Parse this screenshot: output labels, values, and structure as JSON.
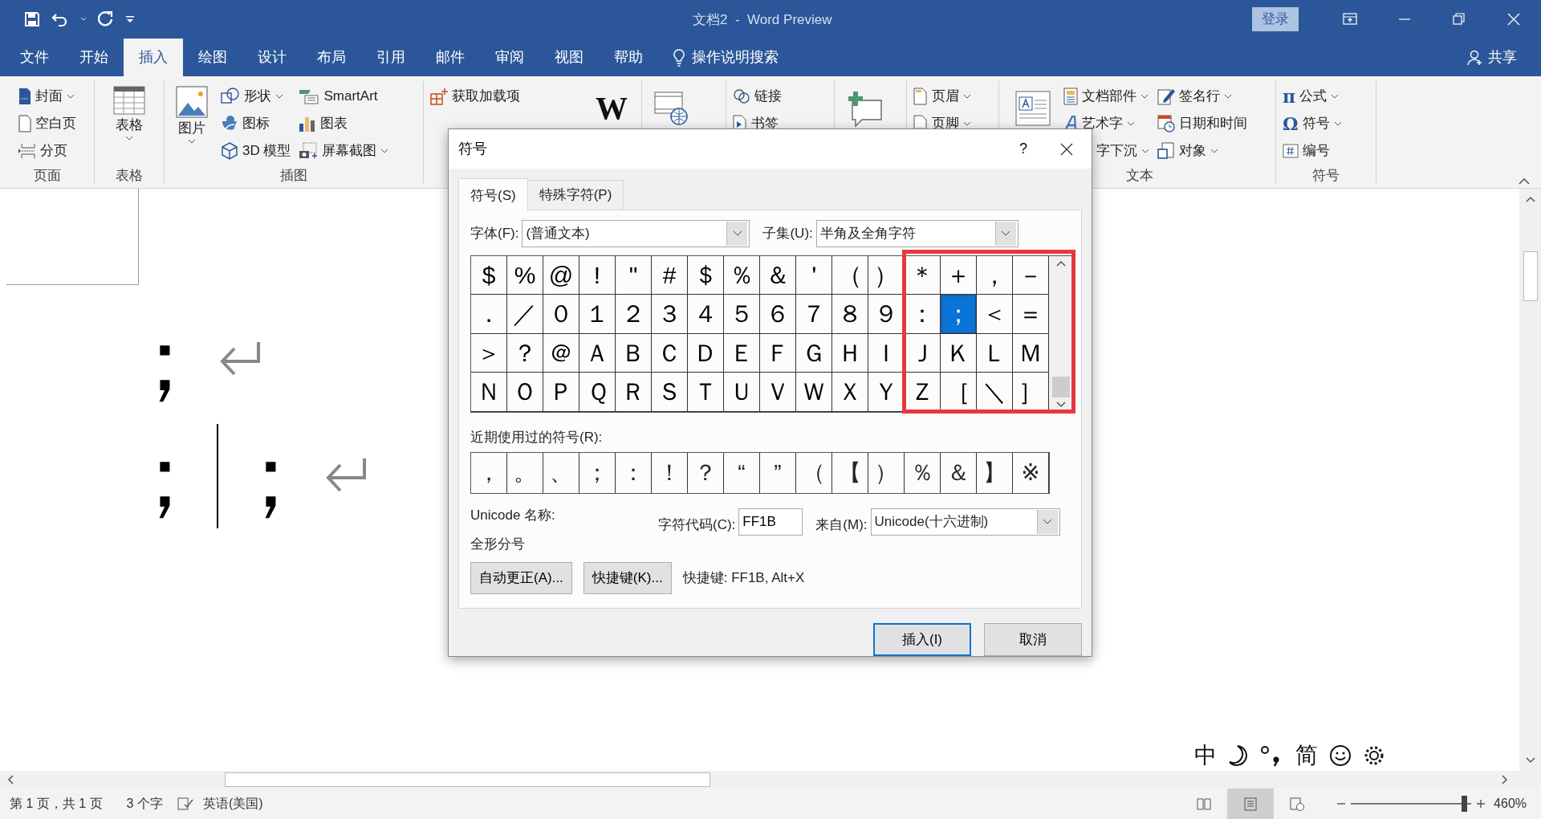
{
  "title_bar": {
    "document_title": "文档2  -  Word Preview",
    "sign_in": "登录"
  },
  "menu_tabs": [
    {
      "label": "文件",
      "selected": false
    },
    {
      "label": "开始",
      "selected": false
    },
    {
      "label": "插入",
      "selected": true
    },
    {
      "label": "绘图",
      "selected": false
    },
    {
      "label": "设计",
      "selected": false
    },
    {
      "label": "布局",
      "selected": false
    },
    {
      "label": "引用",
      "selected": false
    },
    {
      "label": "邮件",
      "selected": false
    },
    {
      "label": "审阅",
      "selected": false
    },
    {
      "label": "视图",
      "selected": false
    },
    {
      "label": "帮助",
      "selected": false
    }
  ],
  "tell_me": "操作说明搜索",
  "share": "共享",
  "ribbon": {
    "groups": [
      {
        "label": "页面",
        "columns": [
          [
            {
              "kind": "small",
              "label": "封面",
              "dropdown": true
            },
            {
              "kind": "small",
              "label": "空白页",
              "dropdown": false
            },
            {
              "kind": "small",
              "label": "分页",
              "dropdown": false
            }
          ]
        ]
      },
      {
        "label": "表格",
        "columns": [
          [
            {
              "kind": "large",
              "label": "表格",
              "dropdown": true
            }
          ]
        ]
      },
      {
        "label": "插图",
        "columns": [
          [
            {
              "kind": "large",
              "label": "图片",
              "dropdown": true
            }
          ],
          [
            {
              "kind": "small",
              "label": "形状",
              "dropdown": true
            },
            {
              "kind": "small",
              "label": "图标",
              "dropdown": false
            },
            {
              "kind": "small",
              "label": "3D 模型",
              "dropdown": false
            }
          ],
          [
            {
              "kind": "small",
              "label": "SmartArt",
              "dropdown": false
            },
            {
              "kind": "small",
              "label": "图表",
              "dropdown": false
            },
            {
              "kind": "small",
              "label": "屏幕截图",
              "dropdown": true
            }
          ]
        ]
      },
      {
        "columns": [
          [
            {
              "kind": "small",
              "label": "获取加载项",
              "dropdown": false
            }
          ],
          [
            {
              "kind": "logo",
              "label": "W"
            }
          ]
        ]
      },
      {
        "columns": [
          [
            {
              "kind": "large",
              "dropdown": false
            }
          ]
        ]
      },
      {
        "columns": [
          [
            {
              "kind": "small",
              "label": "链接",
              "dropdown": false
            },
            {
              "kind": "small",
              "label": "书签",
              "dropdown": false
            }
          ]
        ]
      },
      {
        "columns": [
          [
            {
              "kind": "large",
              "dropdown": false
            }
          ]
        ]
      },
      {
        "columns": [
          [
            {
              "kind": "small",
              "label": "页眉",
              "dropdown": true
            },
            {
              "kind": "small",
              "label": "页脚",
              "dropdown": true
            }
          ]
        ]
      },
      {
        "label": "文本",
        "columns": [
          [
            {
              "kind": "large",
              "dropdown": false
            }
          ],
          [
            {
              "kind": "small",
              "label": "文档部件",
              "dropdown": true
            },
            {
              "kind": "small",
              "label": "艺术字",
              "dropdown": true
            },
            {
              "kind": "small",
              "label": "字下沉",
              "dropdown": true
            }
          ],
          [
            {
              "kind": "small",
              "label": "签名行",
              "dropdown": true
            },
            {
              "kind": "small",
              "label": "日期和时间",
              "dropdown": false
            },
            {
              "kind": "small",
              "label": "对象",
              "dropdown": true
            }
          ]
        ]
      },
      {
        "label": "符号",
        "columns": [
          [
            {
              "kind": "small",
              "glyph": "π",
              "label": "公式",
              "dropdown": true
            },
            {
              "kind": "small",
              "glyph": "Ω",
              "label": "符号",
              "dropdown": true
            },
            {
              "kind": "small",
              "label": "编号",
              "dropdown": false
            }
          ]
        ]
      }
    ]
  },
  "document": {
    "paragraphs": [
      {
        "runs": [
          {
            "text": "；",
            "cursor_after": false
          }
        ]
      },
      {
        "runs": [
          {
            "text": "；",
            "cursor_after": true
          },
          {
            "text": "；",
            "cursor_after": false
          }
        ]
      }
    ]
  },
  "dialog": {
    "title": "符号",
    "help": "?",
    "tabs": [
      {
        "label": "符号(S)",
        "selected": true
      },
      {
        "label": "特殊字符(P)",
        "selected": false
      }
    ],
    "font_label": "字体(F):",
    "font_value": "(普通文本)",
    "subset_label": "子集(U):",
    "subset_value": "半角及全角字符",
    "symbol_rows": [
      [
        {
          "c": "$",
          "selected": false
        },
        {
          "c": "%",
          "selected": false
        },
        {
          "c": "@",
          "selected": false
        },
        {
          "c": "!",
          "selected": false
        },
        {
          "c": "\"",
          "selected": false
        },
        {
          "c": "#",
          "selected": false
        },
        {
          "c": "＄",
          "selected": false
        },
        {
          "c": "％",
          "selected": false
        },
        {
          "c": "＆",
          "selected": false
        },
        {
          "c": "＇",
          "selected": false
        },
        {
          "c": "（",
          "selected": false
        },
        {
          "c": "）",
          "selected": false
        },
        {
          "c": "＊",
          "selected": false
        },
        {
          "c": "＋",
          "selected": false
        },
        {
          "c": "，",
          "selected": false
        },
        {
          "c": "－",
          "selected": false
        }
      ],
      [
        {
          "c": "．",
          "selected": false
        },
        {
          "c": "／",
          "selected": false
        },
        {
          "c": "０",
          "selected": false
        },
        {
          "c": "１",
          "selected": false
        },
        {
          "c": "２",
          "selected": false
        },
        {
          "c": "３",
          "selected": false
        },
        {
          "c": "４",
          "selected": false
        },
        {
          "c": "５",
          "selected": false
        },
        {
          "c": "６",
          "selected": false
        },
        {
          "c": "７",
          "selected": false
        },
        {
          "c": "８",
          "selected": false
        },
        {
          "c": "９",
          "selected": false
        },
        {
          "c": "：",
          "selected": false
        },
        {
          "c": "；",
          "selected": true
        },
        {
          "c": "＜",
          "selected": false
        },
        {
          "c": "＝",
          "selected": false
        }
      ],
      [
        {
          "c": "＞",
          "selected": false
        },
        {
          "c": "？",
          "selected": false
        },
        {
          "c": "＠",
          "selected": false
        },
        {
          "c": "Ａ",
          "selected": false
        },
        {
          "c": "Ｂ",
          "selected": false
        },
        {
          "c": "Ｃ",
          "selected": false
        },
        {
          "c": "Ｄ",
          "selected": false
        },
        {
          "c": "Ｅ",
          "selected": false
        },
        {
          "c": "Ｆ",
          "selected": false
        },
        {
          "c": "Ｇ",
          "selected": false
        },
        {
          "c": "Ｈ",
          "selected": false
        },
        {
          "c": "Ｉ",
          "selected": false
        },
        {
          "c": "Ｊ",
          "selected": false
        },
        {
          "c": "Ｋ",
          "selected": false
        },
        {
          "c": "Ｌ",
          "selected": false
        },
        {
          "c": "Ｍ",
          "selected": false
        }
      ],
      [
        {
          "c": "Ｎ",
          "selected": false
        },
        {
          "c": "Ｏ",
          "selected": false
        },
        {
          "c": "Ｐ",
          "selected": false
        },
        {
          "c": "Ｑ",
          "selected": false
        },
        {
          "c": "Ｒ",
          "selected": false
        },
        {
          "c": "Ｓ",
          "selected": false
        },
        {
          "c": "Ｔ",
          "selected": false
        },
        {
          "c": "Ｕ",
          "selected": false
        },
        {
          "c": "Ｖ",
          "selected": false
        },
        {
          "c": "Ｗ",
          "selected": false
        },
        {
          "c": "Ｘ",
          "selected": false
        },
        {
          "c": "Ｙ",
          "selected": false
        },
        {
          "c": "Ｚ",
          "selected": false
        },
        {
          "c": "［",
          "selected": false
        },
        {
          "c": "＼",
          "selected": false
        },
        {
          "c": "］",
          "selected": false
        }
      ]
    ],
    "recent_label": "近期使用过的符号(R):",
    "recent": [
      "，",
      "。",
      "、",
      "；",
      "：",
      "！",
      "？",
      "“",
      "”",
      "（",
      "【",
      "）",
      "％",
      "＆",
      "】",
      "※"
    ],
    "unicode_name_label": "Unicode 名称:",
    "unicode_name": "全形分号",
    "char_code_label": "字符代码(C):",
    "char_code": "FF1B",
    "from_label": "来自(M):",
    "from_value": "Unicode(十六进制)",
    "autocorrect_button": "自动更正(A)...",
    "shortcut_button": "快捷键(K)...",
    "shortcut_text": "快捷键: FF1B, Alt+X",
    "insert_button": "插入(I)",
    "cancel_button": "取消"
  },
  "ime_bar": {
    "mode": "中",
    "script": "简"
  },
  "status_bar": {
    "page": "第 1 页，共 1 页",
    "words": "3 个字",
    "language": "英语(美国)",
    "views": [
      {
        "selected": false
      },
      {
        "selected": true
      },
      {
        "selected": false
      }
    ],
    "zoom_level": {
      "level": 0.94
    },
    "zoom": "460%"
  }
}
